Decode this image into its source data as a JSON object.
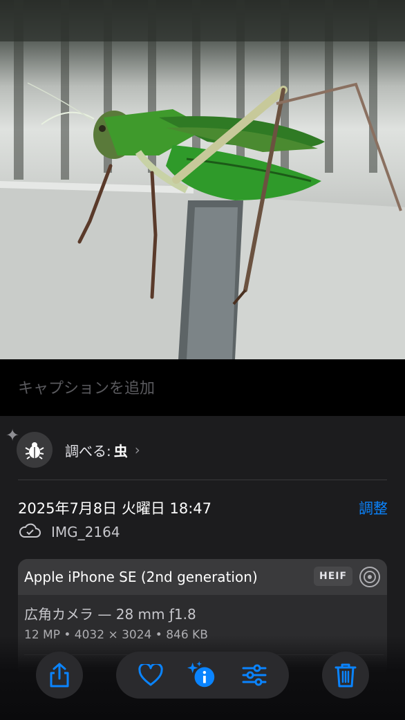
{
  "caption": {
    "placeholder": "キャプションを追加",
    "value": ""
  },
  "lookup": {
    "prefix": "調べる:",
    "value": "虫",
    "icon": "bug-icon"
  },
  "metadata": {
    "datetime": "2025年7月8日 火曜日 18:47",
    "adjust_label": "調整",
    "filename": "IMG_2164",
    "cloud_icon": "icloud-icon"
  },
  "camera": {
    "device": "Apple iPhone SE (2nd generation)",
    "format": "HEIF",
    "lens": "広角カメラ — 28 mm ƒ1.8",
    "specs": "12 MP • 4032 × 3024 • 846 KB"
  },
  "toolbar": {
    "items": [
      "share-icon",
      "heart-icon",
      "info-sparkle-icon",
      "adjust-sliders-icon",
      "trash-icon"
    ]
  },
  "colors": {
    "accent": "#0a84ff",
    "panel": "#1c1c1e",
    "card": "#2c2c2e"
  }
}
